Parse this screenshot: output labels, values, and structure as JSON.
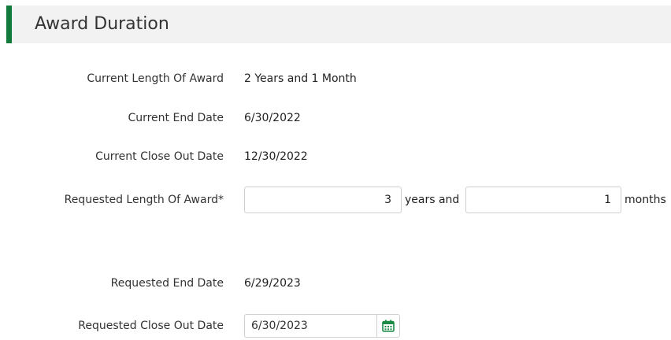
{
  "section": {
    "title": "Award Duration"
  },
  "fields": {
    "current_length": {
      "label": "Current Length Of Award",
      "value": "2 Years and 1 Month"
    },
    "current_end_date": {
      "label": "Current End Date",
      "value": "6/30/2022"
    },
    "current_close_out": {
      "label": "Current Close Out Date",
      "value": "12/30/2022"
    },
    "requested_length": {
      "label": "Requested Length Of Award*",
      "years_value": "3",
      "years_unit": "years and",
      "months_value": "1",
      "months_unit": "months"
    },
    "requested_end_date": {
      "label": "Requested End Date",
      "value": "6/29/2023"
    },
    "requested_close_out": {
      "label": "Requested Close Out Date",
      "value": "6/30/2023"
    }
  },
  "colors": {
    "accent": "#127a3a",
    "header_bg": "#f2f2f2",
    "calendar_icon": "#1a8a45"
  },
  "icons": {
    "date_picker": "calendar-icon"
  }
}
